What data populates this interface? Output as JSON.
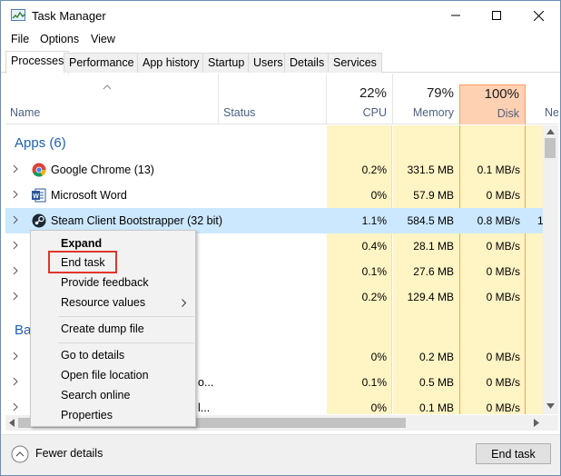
{
  "window": {
    "title": "Task Manager"
  },
  "menu": [
    "File",
    "Options",
    "View"
  ],
  "tabs": [
    {
      "label": "Processes",
      "active": true
    },
    {
      "label": "Performance"
    },
    {
      "label": "App history"
    },
    {
      "label": "Startup"
    },
    {
      "label": "Users"
    },
    {
      "label": "Details"
    },
    {
      "label": "Services"
    }
  ],
  "columns": {
    "name": "Name",
    "status": "Status",
    "cpu": {
      "pct": "22%",
      "label": "CPU"
    },
    "memory": {
      "pct": "79%",
      "label": "Memory"
    },
    "disk": {
      "pct": "100%",
      "label": "Disk"
    },
    "network": {
      "label": "Ne"
    }
  },
  "groups": {
    "apps": "Apps (6)",
    "background": "Ba"
  },
  "rows": [
    {
      "name": "Google Chrome (13)",
      "icon": "chrome-icon",
      "cpu": "0.2%",
      "memory": "331.5 MB",
      "disk": "0.1 MB/s",
      "net": ""
    },
    {
      "name": "Microsoft Word",
      "icon": "word-icon",
      "cpu": "0%",
      "memory": "57.9 MB",
      "disk": "0 MB/s",
      "net": ""
    },
    {
      "name": "Steam Client Bootstrapper (32 bit)",
      "icon": "steam-icon",
      "cpu": "1.1%",
      "memory": "584.5 MB",
      "disk": "0.8 MB/s",
      "net": "1",
      "selected": true
    },
    {
      "name": "",
      "cpu": "0.4%",
      "memory": "28.1 MB",
      "disk": "0 MB/s",
      "net": ""
    },
    {
      "name": "",
      "cpu": "0.1%",
      "memory": "27.6 MB",
      "disk": "0 MB/s",
      "net": ""
    },
    {
      "name": "",
      "cpu": "0.2%",
      "memory": "129.4 MB",
      "disk": "0 MB/s",
      "net": ""
    },
    {
      "name": "",
      "cpu": "0%",
      "memory": "0.2 MB",
      "disk": "0 MB/s",
      "net": ""
    },
    {
      "name": "o...",
      "cpu": "0.1%",
      "memory": "0.5 MB",
      "disk": "0 MB/s",
      "net": ""
    },
    {
      "name": "l...",
      "cpu": "0%",
      "memory": "0.1 MB",
      "disk": "0 MB/s",
      "net": ""
    }
  ],
  "context_menu": {
    "items": [
      "Expand",
      "End task",
      "Provide feedback",
      "Resource values",
      "Create dump file",
      "Go to details",
      "Open file location",
      "Search online",
      "Properties"
    ]
  },
  "footer": {
    "fewer_details": "Fewer details",
    "end_task": "End task"
  },
  "colors": {
    "cpu_mem_bg": "#fff4c4",
    "disk_header_bg": "#ffd1b3",
    "disk_border": "#ff9b65",
    "selection": "#cce8ff",
    "group_text": "#1f5fae",
    "highlight_box": "#e0352b"
  }
}
